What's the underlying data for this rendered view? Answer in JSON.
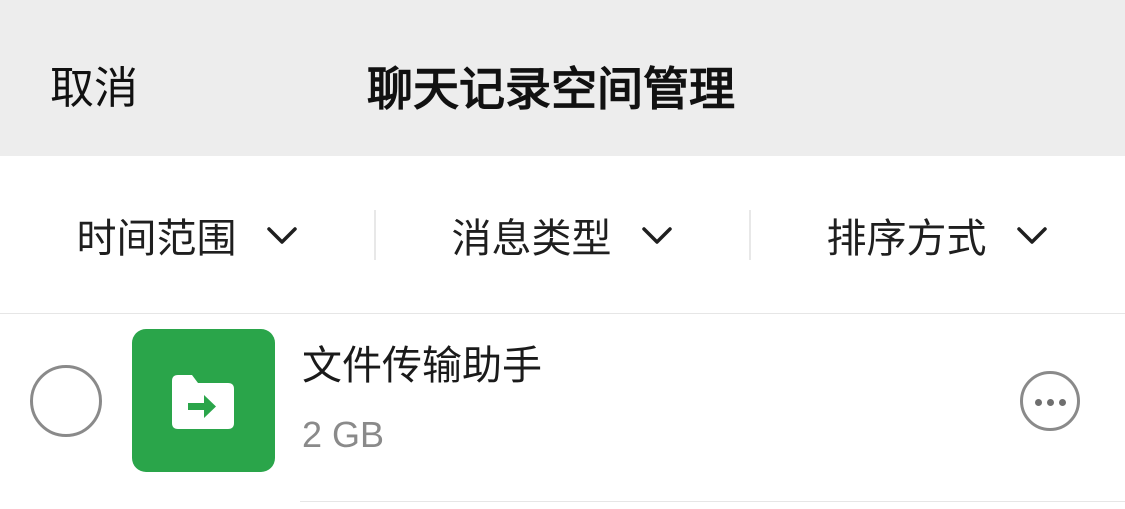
{
  "nav": {
    "cancel_label": "取消",
    "title": "聊天记录空间管理"
  },
  "filters": [
    {
      "label": "时间范围",
      "icon": "chevron-down-icon"
    },
    {
      "label": "消息类型",
      "icon": "chevron-down-icon"
    },
    {
      "label": "排序方式",
      "icon": "chevron-down-icon"
    }
  ],
  "chats": [
    {
      "name": "文件传输助手",
      "size": "2 GB",
      "icon": "folder-transfer-icon",
      "icon_color": "#2aa54a",
      "selected": false
    }
  ],
  "colors": {
    "nav_background": "#ededed",
    "accent_green": "#2aa54a",
    "secondary_text": "#8a8a8a"
  }
}
